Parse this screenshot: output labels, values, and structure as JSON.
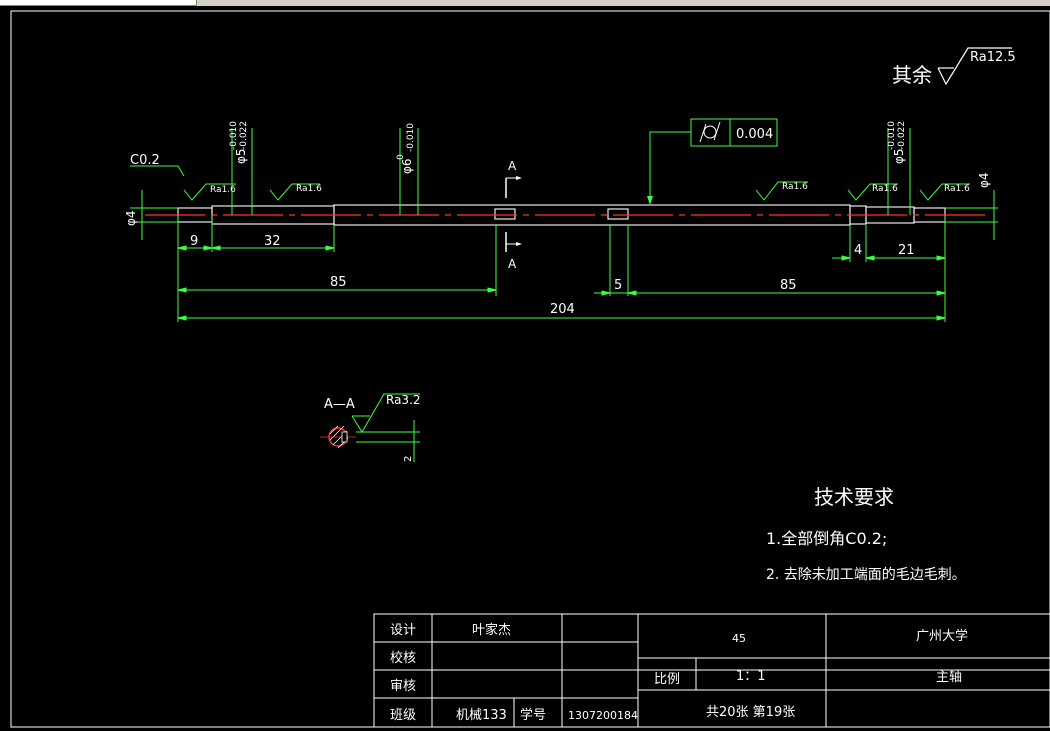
{
  "drawing": {
    "roughness_general": {
      "prefix": "其余",
      "value": "Ra12.5"
    },
    "roughness_marks": [
      "Ra1.6",
      "Ra1.6",
      "Ra1.6",
      "Ra1.6",
      "Ra1.6"
    ],
    "chamfer_label": "C0.2",
    "tolerances": {
      "left_journal": {
        "diameter": "φ5",
        "upper": "-0.010",
        "lower": "-0.022"
      },
      "middle_journal": {
        "diameter": "φ6",
        "upper": "0",
        "lower": "-0.010"
      },
      "right_journal": {
        "diameter": "φ5",
        "upper": "-0.010",
        "lower": "-0.022"
      }
    },
    "end_diameters": {
      "left": "φ4",
      "right": "φ4"
    },
    "geometric_tolerance": {
      "symbol": "cylindricity",
      "value": "0.004"
    },
    "section_marks": {
      "top": "A",
      "bottom": "A"
    },
    "dimensions": {
      "d9": "9",
      "d32": "32",
      "d85_left": "85",
      "d5": "5",
      "d85_right": "85",
      "d204": "204",
      "d4": "4",
      "d21": "21"
    },
    "section_view": {
      "title": "A—A",
      "roughness": "Ra3.2",
      "depth": "2"
    },
    "technical_requirements": {
      "title": "技术要求",
      "items": [
        "1.全部倒角C0.2;",
        "2. 去除未加工端面的毛边毛刺。"
      ]
    }
  },
  "title_block": {
    "design_label": "设计",
    "designer": "叶家杰",
    "check_label": "校核",
    "review_label": "审核",
    "class_label": "班级",
    "class_value": "机械133",
    "student_id_label": "学号",
    "student_id": "1307200184",
    "material": "45",
    "scale_label": "比例",
    "scale_value": "1：1",
    "sheets": "共20张 第19张",
    "university": "广州大学",
    "part_name": "主轴"
  }
}
